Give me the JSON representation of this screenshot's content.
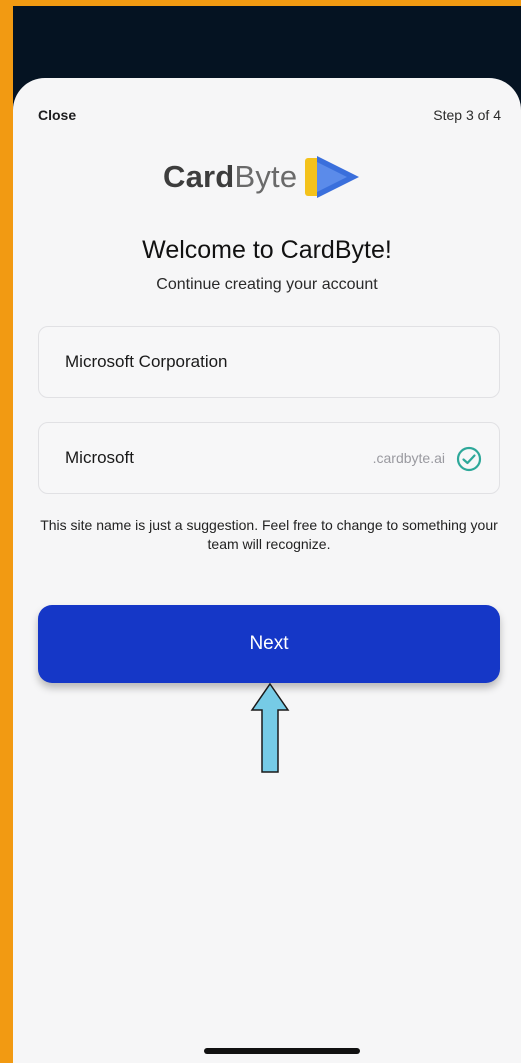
{
  "header": {
    "close_label": "Close",
    "step_label": "Step 3 of 4"
  },
  "logo": {
    "word_bold": "Card",
    "word_light": "Byte",
    "icon": "cardbyte-logo-icon"
  },
  "welcome": {
    "title": "Welcome to CardByte!",
    "subtitle": "Continue creating your account"
  },
  "form": {
    "company_value": "Microsoft Corporation",
    "site_value": "Microsoft",
    "site_suffix": ".cardbyte.ai",
    "site_status_icon": "check-circle-icon",
    "hint": "This site name is just a suggestion. Feel free to change to something your team will recognize."
  },
  "actions": {
    "next_label": "Next"
  },
  "annotation": {
    "icon": "up-arrow-icon"
  },
  "colors": {
    "frame_border": "#f29a12",
    "top_bar": "#051322",
    "primary_button": "#1537c7",
    "check": "#2ea89a",
    "arrow_fill": "#76cbe6"
  }
}
